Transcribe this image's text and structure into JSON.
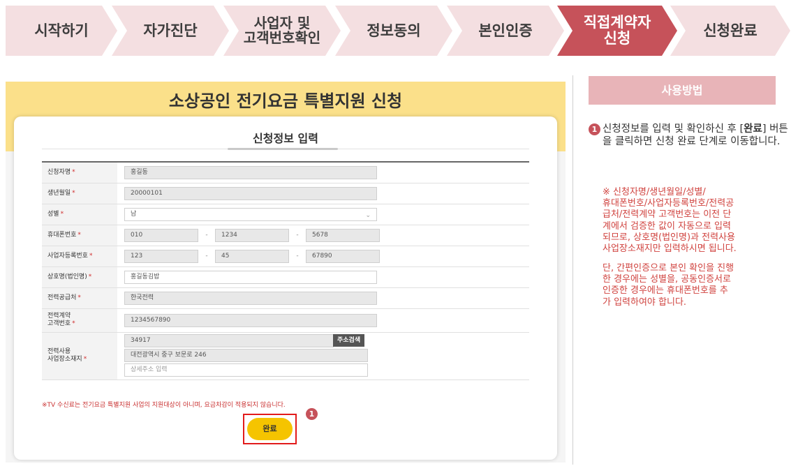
{
  "steps": [
    {
      "label": "시작하기"
    },
    {
      "label": "자가진단"
    },
    {
      "label": "사업자 및\n고객번호확인"
    },
    {
      "label": "정보동의"
    },
    {
      "label": "본인인증"
    },
    {
      "label": "직접계약자\n신청",
      "active": true
    },
    {
      "label": "신청완료"
    }
  ],
  "banner": {
    "title": "소상공인 전기요금 특별지원 신청"
  },
  "card": {
    "title": "신청정보 입력"
  },
  "form": {
    "required_mark": "*",
    "name": {
      "label": "신청자명",
      "value": "홍길동"
    },
    "birth": {
      "label": "생년월일",
      "value": "20000101"
    },
    "gender": {
      "label": "성별",
      "value": "남"
    },
    "phone": {
      "label": "휴대폰번호",
      "p1": "010",
      "p2": "1234",
      "p3": "5678",
      "sep": "-"
    },
    "bizno": {
      "label": "사업자등록번호",
      "p1": "123",
      "p2": "45",
      "p3": "67890",
      "sep": "-"
    },
    "company": {
      "label": "상호명(법인명)",
      "value": "홍길동김밥"
    },
    "supplier": {
      "label": "전력공급처",
      "value": "한국전력"
    },
    "customer_no": {
      "label": "전력계약\n고객번호",
      "value": "1234567890"
    },
    "address": {
      "label": "전력사용\n사업장소재지",
      "zip": "34917",
      "search_button": "주소검색",
      "addr1": "대전광역시 중구 보문로 246",
      "addr2_placeholder": "상세주소 입력"
    }
  },
  "notice": "※TV 수신료는 전기요금 특별지원 사업의 지원대상이 아니며, 요금차감이 적용되지 않습니다.",
  "submit_label": "완료",
  "badge_number": "1",
  "help": {
    "title": "사용방법",
    "step_number": "1",
    "text_pre": "신청정보를 입력 및 확인하신 후 [",
    "text_bold": "완료",
    "text_post": "] 버튼을 클릭하면 신청 완료 단계로 이동합니다.",
    "note1": "※ 신청자명/생년월일/성별/\n휴대폰번호/사업자등록번호/전력공\n급처/전력계약 고객번호는 이전 단\n계에서 검증한 값이 자동으로 입력\n되므로, 상호명(법인명)과 전력사용\n사업장소재지만 입력하시면 됩니다.",
    "note2": "단, 간편인증으로 본인 확인을 진행\n한 경우에는 성별을, 공동인증서로\n인증한 경우에는 휴대폰번호를 추\n가 입력하여야 합니다."
  },
  "colors": {
    "active_step": "#c6525a",
    "inactive_step": "#f4dfe1",
    "banner": "#fbe08a",
    "submit": "#f5c400"
  }
}
